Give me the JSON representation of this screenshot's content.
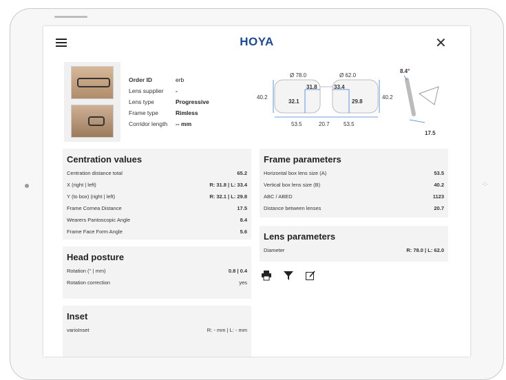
{
  "app": {
    "logo": "HOYA"
  },
  "order": {
    "rows": [
      {
        "label": "Order ID",
        "value": "erb",
        "bold_value": false
      },
      {
        "label": "Lens supplier",
        "value": "-",
        "bold_value": false
      },
      {
        "label": "Lens type",
        "value": "Progressive",
        "bold_value": true
      },
      {
        "label": "Frame type",
        "value": "Rimless",
        "bold_value": true
      },
      {
        "label": "Corridor length",
        "value": "-- mm",
        "bold_value": true
      }
    ]
  },
  "diagram": {
    "left_diameter": "Ø 78.0",
    "right_diameter": "Ø 62.0",
    "left_height": "40.2",
    "right_height": "40.2",
    "x_right": "31.8",
    "x_left": "33.4",
    "y_right": "32.1",
    "y_left": "29.8",
    "width_left": "53.5",
    "bridge": "20.7",
    "width_right": "53.5",
    "pantoscopic": "8.4°",
    "cornea": "17.5"
  },
  "centration": {
    "title": "Centration values",
    "rows": [
      {
        "label": "Centration distance total",
        "value": "65.2"
      },
      {
        "label": "X (right | left)",
        "value": "R: 31.8 | L: 33.4"
      },
      {
        "label": "Y (to box) (right | left)",
        "value": "R: 32.1 | L: 29.8"
      },
      {
        "label": "Frame Cornea Distance",
        "value": "17.5"
      },
      {
        "label": "Wearers Pantoscopic Angle",
        "value": "8.4"
      },
      {
        "label": "Frame Face Form Angle",
        "value": "5.6"
      }
    ]
  },
  "head_posture": {
    "title": "Head posture",
    "rows": [
      {
        "label": "Rotation (° | mm)",
        "value": "0.8 | 0.4"
      },
      {
        "label": "Rotation correction",
        "value": "yes"
      }
    ]
  },
  "inset": {
    "title": "Inset",
    "rows": [
      {
        "label": "varioInset",
        "value": "R: - mm | L: - mm"
      }
    ]
  },
  "frame_params": {
    "title": "Frame parameters",
    "rows": [
      {
        "label": "Horizontal box lens size (A)",
        "value": "53.5"
      },
      {
        "label": "Vertical box lens size (B)",
        "value": "40.2"
      },
      {
        "label": "ABC / ABED",
        "value": "1123"
      },
      {
        "label": "Distance between lenses",
        "value": "20.7"
      }
    ]
  },
  "lens_params": {
    "title": "Lens parameters",
    "rows": [
      {
        "label": "Diameter",
        "value": "R: 78.0 | L: 62.0"
      }
    ]
  },
  "icons": [
    "printer-icon",
    "filter-icon",
    "edit-icon"
  ],
  "colors": {
    "brand": "#1b4a9c",
    "panel": "#f3f3f3",
    "dimension": "#3a7bd5"
  }
}
